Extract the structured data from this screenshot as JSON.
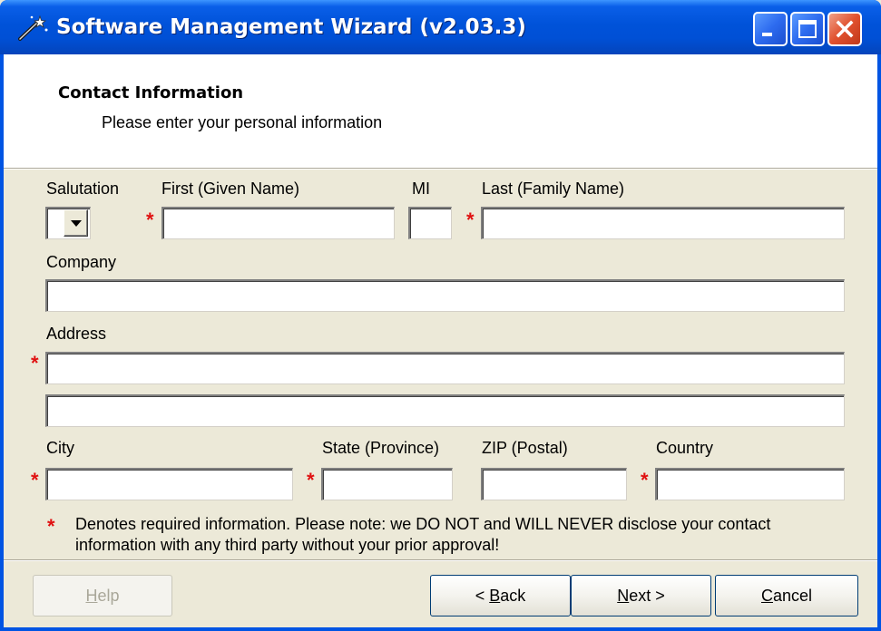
{
  "window": {
    "title": "Software Management Wizard (v2.03.3)",
    "icons": [
      "wand-icon",
      "minimize-icon",
      "maximize-icon",
      "close-icon"
    ]
  },
  "header": {
    "title": "Contact Information",
    "subtitle": "Please enter your personal information"
  },
  "form": {
    "salutation_label": "Salutation",
    "salutation_value": "",
    "first_label": "First (Given Name)",
    "first_value": "",
    "mi_label": "MI",
    "mi_value": "",
    "last_label": "Last (Family Name)",
    "last_value": "",
    "company_label": "Company",
    "company_value": "",
    "address_label": "Address",
    "address1_value": "",
    "address2_value": "",
    "city_label": "City",
    "city_value": "",
    "state_label": "State (Province)",
    "state_value": "",
    "zip_label": "ZIP (Postal)",
    "zip_value": "",
    "country_label": "Country",
    "country_value": "",
    "required_marker": "*"
  },
  "note": {
    "marker": "*",
    "text": "Denotes required information. Please note: we DO NOT and WILL NEVER disclose your contact information with any third party without your prior approval!"
  },
  "buttons": {
    "help": {
      "mnemonic": "H",
      "rest": "elp",
      "enabled": false
    },
    "back": {
      "prefix": "< ",
      "mnemonic": "B",
      "rest": "ack"
    },
    "next": {
      "mnemonic": "N",
      "rest": "ext >"
    },
    "cancel": {
      "mnemonic": "C",
      "rest": "ancel"
    }
  },
  "colors": {
    "titlebar": "#0054E3",
    "required": "#E01010",
    "face": "#ECE9D8"
  }
}
